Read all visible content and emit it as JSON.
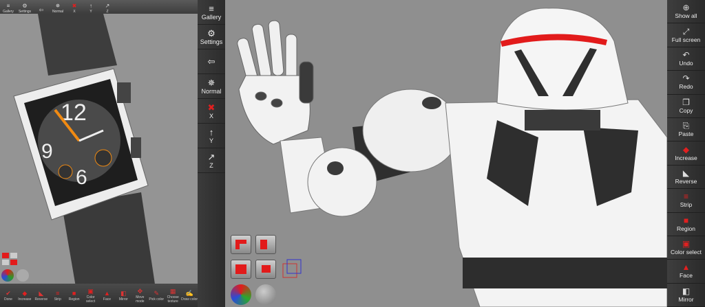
{
  "left_pane": {
    "top_buttons": [
      {
        "icon": "gallery-icon",
        "label": "Gallery"
      },
      {
        "icon": "settings-icon",
        "label": "Settings"
      },
      {
        "icon": "arrow-icon",
        "label": ""
      },
      {
        "icon": "normal-axis-icon",
        "label": "Normal"
      },
      {
        "icon": "x-axis-icon",
        "label": "X"
      },
      {
        "icon": "y-axis-icon",
        "label": "Y"
      },
      {
        "icon": "z-axis-icon",
        "label": "Z"
      }
    ],
    "bottom_buttons": [
      {
        "icon": "done-icon",
        "label": "Done"
      },
      {
        "icon": "increase-icon",
        "label": "Increase"
      },
      {
        "icon": "reverse-icon",
        "label": "Reverse"
      },
      {
        "icon": "strip-icon",
        "label": "Strip"
      },
      {
        "icon": "region-icon",
        "label": "Region"
      },
      {
        "icon": "color-select-icon",
        "label": "Color select"
      },
      {
        "icon": "face-icon",
        "label": "Face"
      },
      {
        "icon": "mirror-icon",
        "label": "Mirror"
      },
      {
        "icon": "move-mode-icon",
        "label": "Move mode"
      },
      {
        "icon": "pick-color-icon",
        "label": "Pick color"
      },
      {
        "icon": "choose-texture-icon",
        "label": "Choose texture"
      },
      {
        "icon": "draw-icon",
        "label": "Draw color"
      }
    ]
  },
  "middle_toolbar": [
    {
      "icon": "gallery-icon",
      "label": "Gallery"
    },
    {
      "icon": "settings-icon",
      "label": "Settings"
    },
    {
      "icon": "arrow-left-icon",
      "label": ""
    },
    {
      "icon": "normal-axis-icon",
      "label": "Normal"
    },
    {
      "icon": "x-axis-icon",
      "label": "X"
    },
    {
      "icon": "y-axis-icon",
      "label": "Y"
    },
    {
      "icon": "z-axis-icon",
      "label": "Z"
    }
  ],
  "right_toolbar": [
    {
      "icon": "zoom-icon",
      "label": "Show all"
    },
    {
      "icon": "fullscreen-icon",
      "label": "Full screen"
    },
    {
      "icon": "undo-icon",
      "label": "Undo"
    },
    {
      "icon": "redo-icon",
      "label": "Redo"
    },
    {
      "icon": "copy-icon",
      "label": "Copy"
    },
    {
      "icon": "paste-icon",
      "label": "Paste"
    },
    {
      "icon": "increase-icon",
      "label": "Increase"
    },
    {
      "icon": "reverse-icon",
      "label": "Reverse"
    },
    {
      "icon": "strip-icon",
      "label": "Strip"
    },
    {
      "icon": "region-icon",
      "label": "Region"
    },
    {
      "icon": "color-select-icon",
      "label": "Color select"
    },
    {
      "icon": "face-icon",
      "label": "Face"
    },
    {
      "icon": "mirror-icon",
      "label": "Mirror"
    }
  ],
  "colors": {
    "accent": "#e21b1b",
    "toolbar": "#333333",
    "model": "#f2f2f2",
    "model_dark": "#3a3a3a",
    "viewport": "#8f8f8f"
  }
}
